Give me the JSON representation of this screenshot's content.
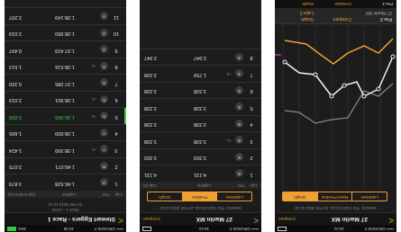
{
  "phones": [
    {
      "status": {
        "carrier": "••••• ORANGE F",
        "time": "15:36",
        "battery": "36%"
      },
      "nav": {
        "back": "<",
        "title": "Stewart Eggers - Race 1",
        "right": ""
      },
      "subtitle": {
        "line1": "Race 1 - 14:53",
        "line2": "24 Feb 2013 11:10"
      },
      "columns": [
        "Lap",
        "Pos",
        "Laptime",
        "Gap to Best Lap"
      ],
      "laps": [
        {
          "lap": "1",
          "pos": "3",
          "gap": "",
          "time": "1:45.528",
          "best": "3.879"
        },
        {
          "lap": "2",
          "pos": "8",
          "gap": "",
          "time": "1:40.071",
          "best": "2.075"
        },
        {
          "lap": "3",
          "pos": "7",
          "gap": "+1",
          "time": "1:38.390",
          "best": "1.424"
        },
        {
          "lap": "4",
          "pos": "7",
          "gap": "",
          "time": "1:38.000",
          "best": "1.665"
        },
        {
          "lap": "5",
          "pos": "5",
          "gap": "+1",
          "time": "1:36.965",
          "best": "0.000"
        },
        {
          "lap": "6",
          "pos": "5",
          "gap": "+1",
          "time": "1:38.901",
          "best": "2.019"
        },
        {
          "lap": "7",
          "pos": "5",
          "gap": "",
          "time": "1:37.285",
          "best": "0.320"
        },
        {
          "lap": "8",
          "pos": "4",
          "gap": "+1",
          "time": "1:38.516",
          "best": "1.513"
        },
        {
          "lap": "9",
          "pos": "4",
          "gap": "",
          "time": "1:37.433",
          "best": "0.497"
        },
        {
          "lap": "10",
          "pos": "4",
          "gap": "",
          "time": "1:38.950",
          "best": "2.019"
        },
        {
          "lap": "11",
          "pos": "4",
          "gap": "",
          "time": "1:38.149",
          "best": "2.207"
        }
      ],
      "highlight_lap": "5"
    },
    {
      "status": {
        "carrier": "••••• ORANGE F",
        "time": "15:41",
        "battery": ""
      },
      "nav": {
        "back": "<",
        "title": "27 Marlin MX",
        "right": "Compare"
      },
      "subtitle": {
        "line1": "Session: The Club Circuit, 24 Feb 2013 11:10",
        "line2": ""
      },
      "tabs": [
        "Laptimes",
        "Position",
        "Graph"
      ],
      "active_tab": "Position",
      "columns": [
        "Lap",
        "Pos",
        "Laptime",
        "Gap (S)"
      ],
      "laps": [
        {
          "lap": "1",
          "pos": "6",
          "gap": "",
          "time": "4:131",
          "best": "4.131"
        },
        {
          "lap": "2",
          "pos": "6",
          "gap": "",
          "time": "3.303",
          "best": "3.303"
        },
        {
          "lap": "3",
          "pos": "5",
          "gap": "+1",
          "time": "3.338",
          "best": "3.338"
        },
        {
          "lap": "4",
          "pos": "5",
          "gap": "",
          "time": "3.338",
          "best": "3.338"
        },
        {
          "lap": "5",
          "pos": "5",
          "gap": "",
          "time": "3.338",
          "best": "3.338"
        },
        {
          "lap": "6",
          "pos": "5",
          "gap": "",
          "time": "3.338",
          "best": "3.338"
        },
        {
          "lap": "7",
          "pos": "3",
          "gap": "+2",
          "time": "1.750",
          "best": "3.338"
        },
        {
          "lap": "8",
          "pos": "3",
          "gap": "",
          "time": "2.947",
          "best": "2.947"
        }
      ]
    },
    {
      "status": {
        "carrier": "••••• ORANGE F",
        "time": "15:41",
        "battery": ""
      },
      "nav": {
        "back": "<",
        "title": "27 Marlin MX",
        "right": "Compare"
      },
      "subtitle": {
        "line1": "Session: The Club Circuit, 24 Feb 2013 11:10",
        "line2": ""
      },
      "tabs": [
        "Laptimes",
        "Race Position",
        "Graph"
      ],
      "active_tab": "Graph",
      "header": {
        "name": "Pos 3",
        "car": "27 Marlin MX",
        "laps_label": "Laps 3",
        "compare": "Compare",
        "stat": "Graph"
      },
      "topbar": [
        "Pos 3",
        "Compare",
        "Graph"
      ]
    }
  ]
}
